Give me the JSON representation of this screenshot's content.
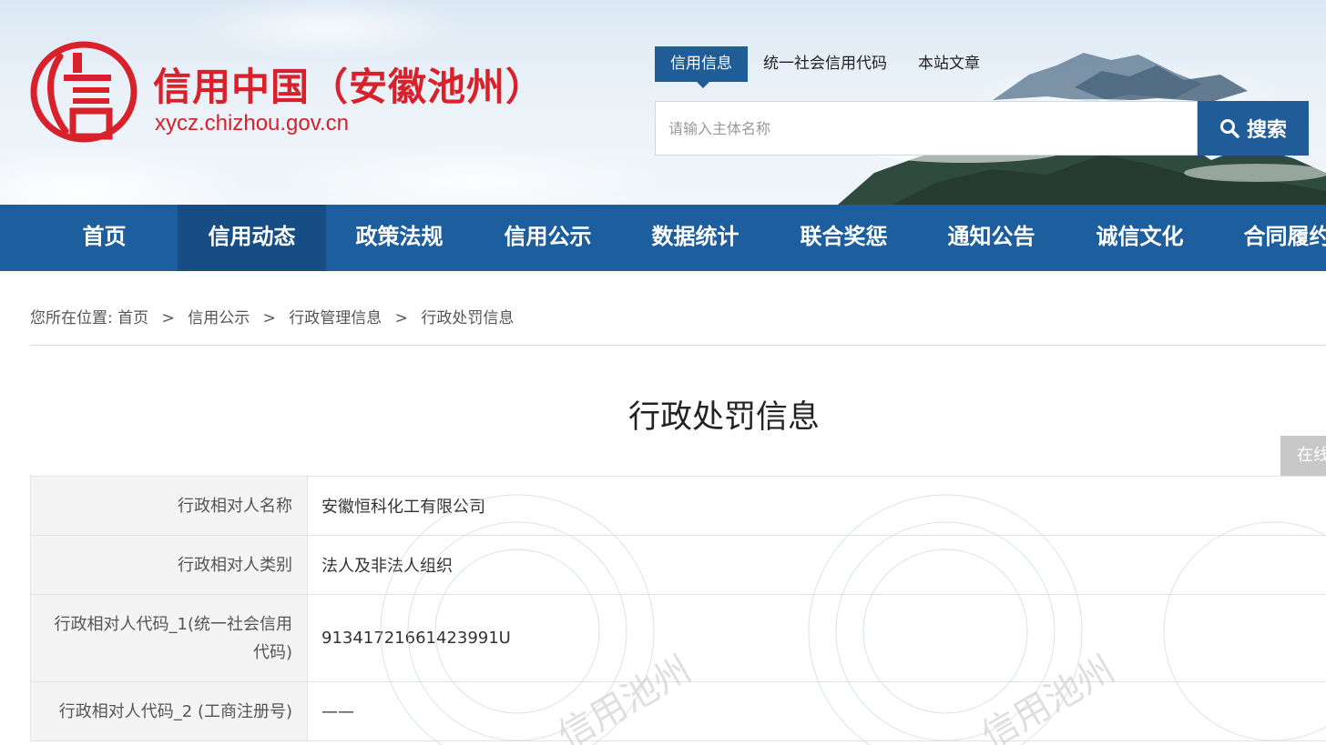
{
  "header": {
    "logo_glyph": "信",
    "site_title": "信用中国（安徽池州）",
    "site_domain": "xycz.chizhou.gov.cn",
    "search_tabs": [
      {
        "label": "信用信息",
        "active": true
      },
      {
        "label": "统一社会信用代码",
        "active": false
      },
      {
        "label": "本站文章",
        "active": false
      }
    ],
    "search_placeholder": "请输入主体名称",
    "search_button_label": "搜索",
    "brand_red": "#d8212b",
    "brand_blue": "#1f5c98"
  },
  "nav": {
    "items": [
      {
        "label": "首页",
        "active": false
      },
      {
        "label": "信用动态",
        "active": true
      },
      {
        "label": "政策法规",
        "active": false
      },
      {
        "label": "信用公示",
        "active": false
      },
      {
        "label": "数据统计",
        "active": false
      },
      {
        "label": "联合奖惩",
        "active": false
      },
      {
        "label": "通知公告",
        "active": false
      },
      {
        "label": "诚信文化",
        "active": false
      },
      {
        "label": "合同履约",
        "active": false
      }
    ]
  },
  "breadcrumb": {
    "prefix": "您所在位置:",
    "separator": ">",
    "items": [
      "首页",
      "信用公示",
      "行政管理信息",
      "行政处罚信息"
    ]
  },
  "page": {
    "title": "行政处罚信息",
    "online_button_label": "在线"
  },
  "details": {
    "rows": [
      {
        "label": "行政相对人名称",
        "value": "安徽恒科化工有限公司"
      },
      {
        "label": "行政相对人类别",
        "value": "法人及非法人组织"
      },
      {
        "label": "行政相对人代码_1(统一社会信用代码)",
        "value": "91341721661423991U"
      },
      {
        "label": "行政相对人代码_2 (工商注册号)",
        "value": "——"
      }
    ],
    "watermark_text": "信用池州"
  }
}
